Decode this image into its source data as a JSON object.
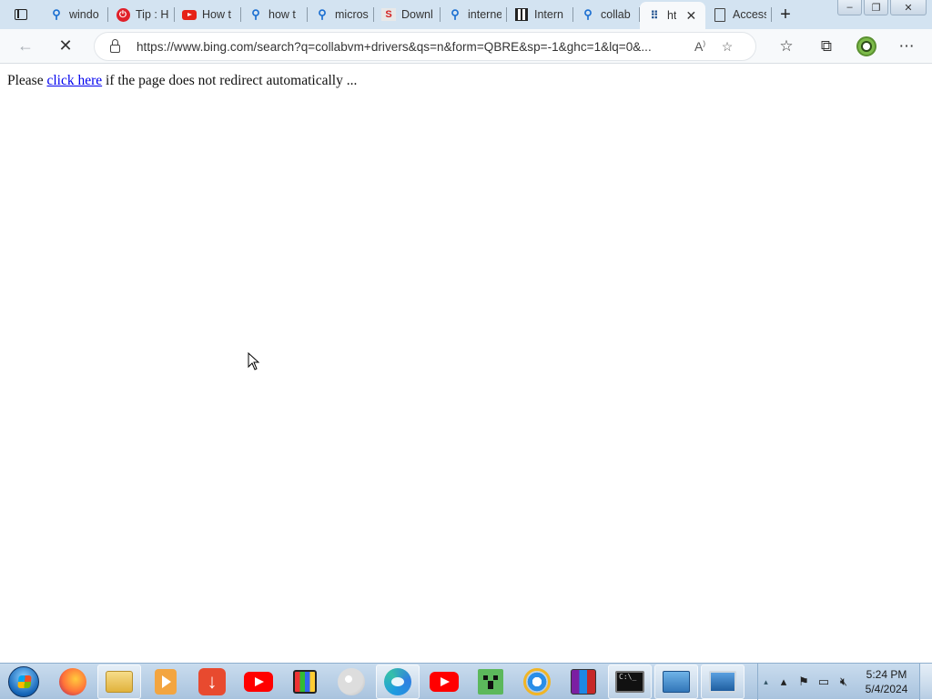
{
  "browser": {
    "tabs": [
      {
        "label": "windo",
        "favicon": "search-icon"
      },
      {
        "label": "Tip : H",
        "favicon": "power-icon"
      },
      {
        "label": "How t",
        "favicon": "youtube-icon"
      },
      {
        "label": "how t",
        "favicon": "search-icon"
      },
      {
        "label": "micros",
        "favicon": "search-icon"
      },
      {
        "label": "Downl",
        "favicon": "download-site-icon"
      },
      {
        "label": "interne",
        "favicon": "search-icon"
      },
      {
        "label": "Intern",
        "favicon": "archive-icon"
      },
      {
        "label": "collab",
        "favicon": "search-icon"
      },
      {
        "label": "ht",
        "favicon": "loading-icon",
        "active": true,
        "close": "✕"
      },
      {
        "label": "Access",
        "favicon": "document-icon"
      }
    ],
    "new_tab_label": "+",
    "window_controls": {
      "minimize": "–",
      "restore": "❐",
      "close": "✕"
    },
    "address_bar": {
      "url": "https://www.bing.com/search?q=collabvm+drivers&qs=n&form=QBRE&sp=-1&ghc=1&lq=0&..."
    }
  },
  "page": {
    "text_before": "Please ",
    "link_text": "click here",
    "text_after": " if the page does not redirect automatically ..."
  },
  "taskbar": {
    "apps": [
      {
        "name": "firefox-icon",
        "pinned": false
      },
      {
        "name": "folder-icon",
        "pinned": true
      },
      {
        "name": "media-player-icon",
        "pinned": false
      },
      {
        "name": "download-icon",
        "pinned": false
      },
      {
        "name": "youtube-icon",
        "pinned": false
      },
      {
        "name": "store-bag-icon",
        "pinned": false
      },
      {
        "name": "paint-icon",
        "pinned": false
      },
      {
        "name": "edge-icon",
        "pinned": true
      },
      {
        "name": "youtube-icon",
        "pinned": false
      },
      {
        "name": "creeper-icon",
        "pinned": false
      },
      {
        "name": "internet-explorer-icon",
        "pinned": false
      },
      {
        "name": "winrar-icon",
        "pinned": false
      },
      {
        "name": "command-prompt-icon",
        "pinned": true
      },
      {
        "name": "network-icon",
        "pinned": true
      },
      {
        "name": "computer-icon",
        "pinned": true
      }
    ],
    "clock": {
      "time": "5:24 PM",
      "date": "5/4/2024"
    }
  },
  "colors": {
    "tabstrip": "#d3e3f1",
    "toolbar": "#f7f9fb",
    "link": "#0000ee",
    "taskbar": "#b9d0e7"
  }
}
